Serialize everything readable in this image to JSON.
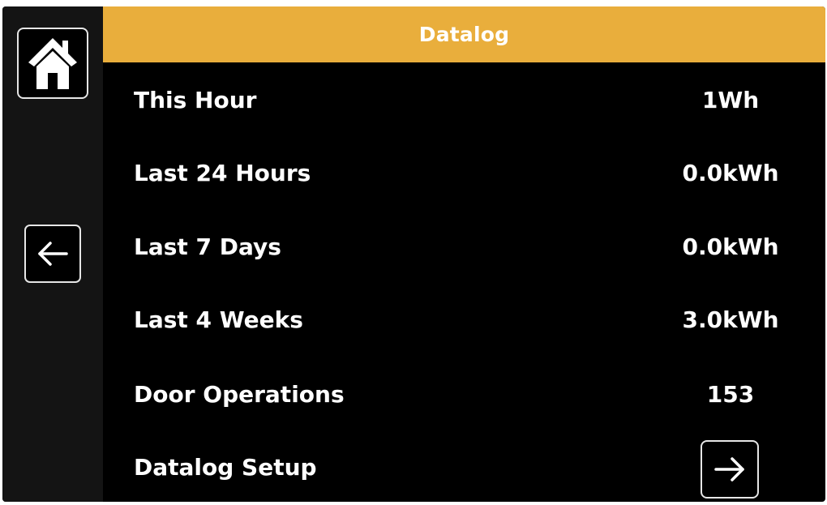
{
  "header": {
    "title": "Datalog"
  },
  "nav": {
    "home_icon": "home-icon",
    "back_icon": "arrow-left-icon",
    "next_icon": "arrow-right-icon"
  },
  "rows": [
    {
      "label": "This Hour",
      "value": "1Wh"
    },
    {
      "label": "Last 24 Hours",
      "value": "0.0kWh"
    },
    {
      "label": "Last 7 Days",
      "value": "0.0kWh"
    },
    {
      "label": "Last 4 Weeks",
      "value": "3.0kWh"
    },
    {
      "label": "Door Operations",
      "value": "153"
    },
    {
      "label": "Datalog Setup",
      "value": ""
    }
  ],
  "colors": {
    "accent": "#e9ae3c",
    "background": "#000000",
    "sidebar": "#141414",
    "text": "#ffffff"
  }
}
